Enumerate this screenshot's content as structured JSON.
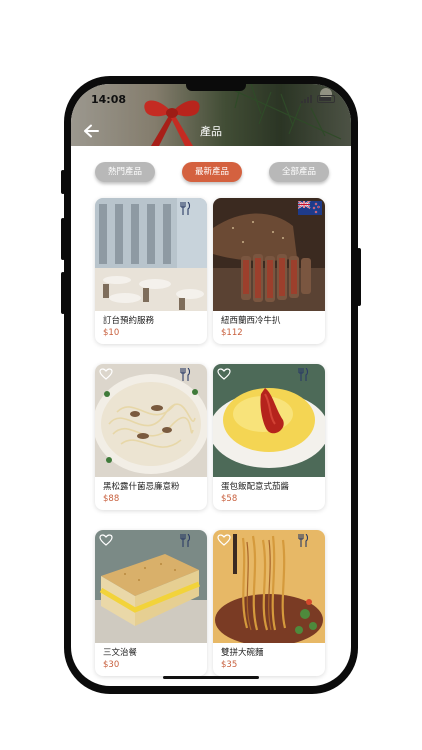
{
  "status": {
    "time": "14:08"
  },
  "header": {
    "title": "產品"
  },
  "tabs": [
    {
      "label": "熱門產品",
      "active": false
    },
    {
      "label": "最新產品",
      "active": true
    },
    {
      "label": "全部產品",
      "active": false
    }
  ],
  "products": [
    {
      "name": "訂台預約服務",
      "price": "$10",
      "photo": "restaurant-interior",
      "icons": [
        "utensils-icon"
      ]
    },
    {
      "name": "紐西蘭西冷牛扒",
      "price": "$112",
      "photo": "sirloin-steak",
      "icons": [
        "new-zealand-flag-icon"
      ]
    },
    {
      "name": "黑松露什菌忌廉意粉",
      "price": "$88",
      "photo": "truffle-pasta",
      "icons": [
        "heart-icon",
        "utensils-icon"
      ]
    },
    {
      "name": "蛋包飯配意式茄醬",
      "price": "$58",
      "photo": "omelette-rice",
      "icons": [
        "heart-icon",
        "utensils-icon"
      ]
    },
    {
      "name": "三文治餐",
      "price": "$30",
      "photo": "sandwich",
      "icons": [
        "heart-icon",
        "utensils-icon"
      ]
    },
    {
      "name": "雙拼大碗麵",
      "price": "$35",
      "photo": "noodle-bowl",
      "icons": [
        "heart-icon",
        "utensils-icon"
      ]
    }
  ],
  "colors": {
    "accent": "#d4613f",
    "price": "#c8603e",
    "tab_inactive": "#b8b8b8",
    "phone_frame": "#0b0b0b"
  }
}
